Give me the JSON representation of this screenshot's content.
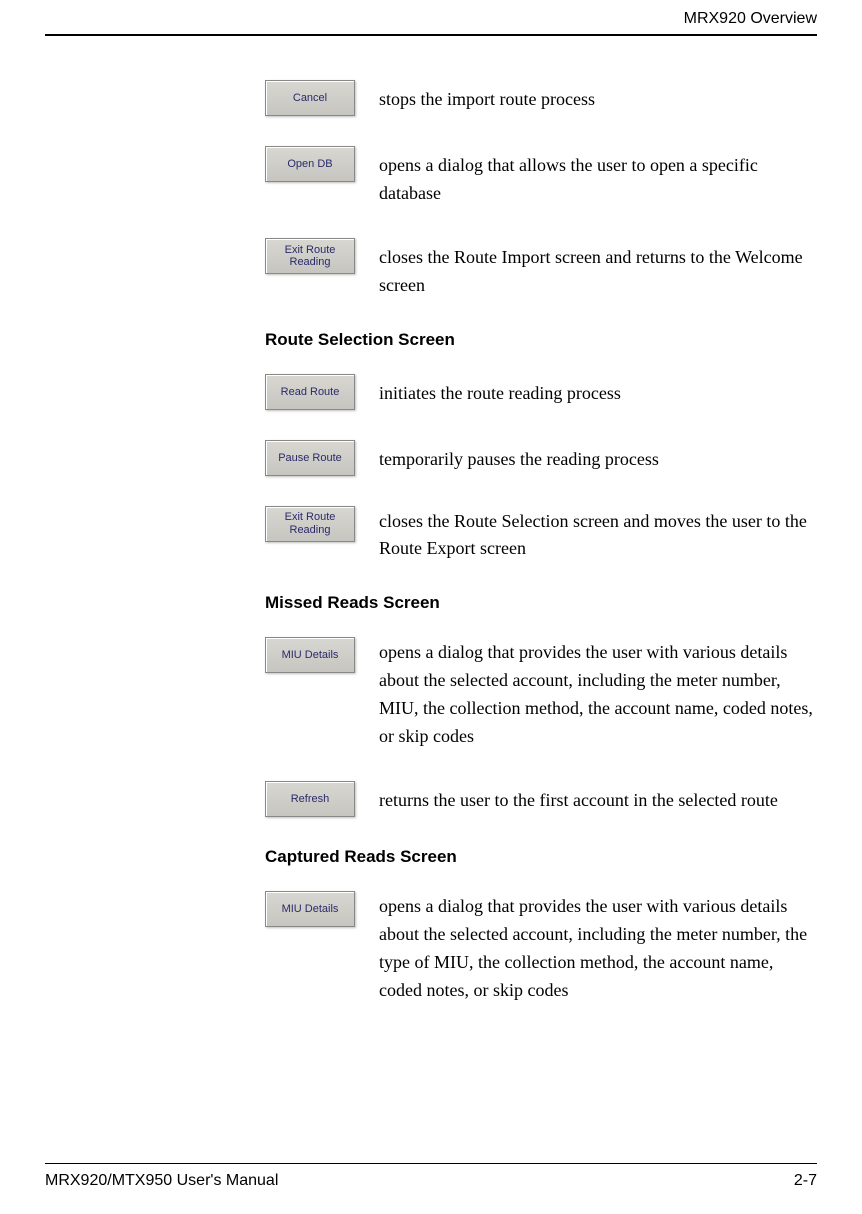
{
  "header": {
    "title": "MRX920 Overview"
  },
  "sections": [
    {
      "items": [
        {
          "button": "Cancel",
          "desc": "stops the import route process"
        },
        {
          "button": "Open DB",
          "desc": "opens a dialog that allows the user to open a specific database"
        },
        {
          "button": "Exit Route\nReading",
          "desc": "closes the Route Import screen and returns to the Welcome screen"
        }
      ]
    },
    {
      "heading": "Route Selection Screen",
      "items": [
        {
          "button": "Read Route",
          "desc": "initiates the route reading process"
        },
        {
          "button": "Pause Route",
          "desc": "temporarily pauses the reading process"
        },
        {
          "button": "Exit Route\nReading",
          "desc": "closes the Route Selection screen and moves the user to the Route Export screen"
        }
      ]
    },
    {
      "heading": "Missed Reads Screen",
      "items": [
        {
          "button": "MIU Details",
          "desc": "opens a dialog that provides the user with various details about the selected account, including the meter number, MIU, the collection method, the account name, coded notes, or skip codes"
        },
        {
          "button": "Refresh",
          "desc": "returns the user to the first account in the selected route"
        }
      ]
    },
    {
      "heading": "Captured Reads Screen",
      "items": [
        {
          "button": "MIU Details",
          "desc": "opens a dialog that provides the user with various details about the selected account, including the meter number, the type of MIU, the collection method, the account name, coded notes, or skip codes"
        }
      ]
    }
  ],
  "footer": {
    "left": "MRX920/MTX950 User's Manual",
    "right": "2-7"
  }
}
